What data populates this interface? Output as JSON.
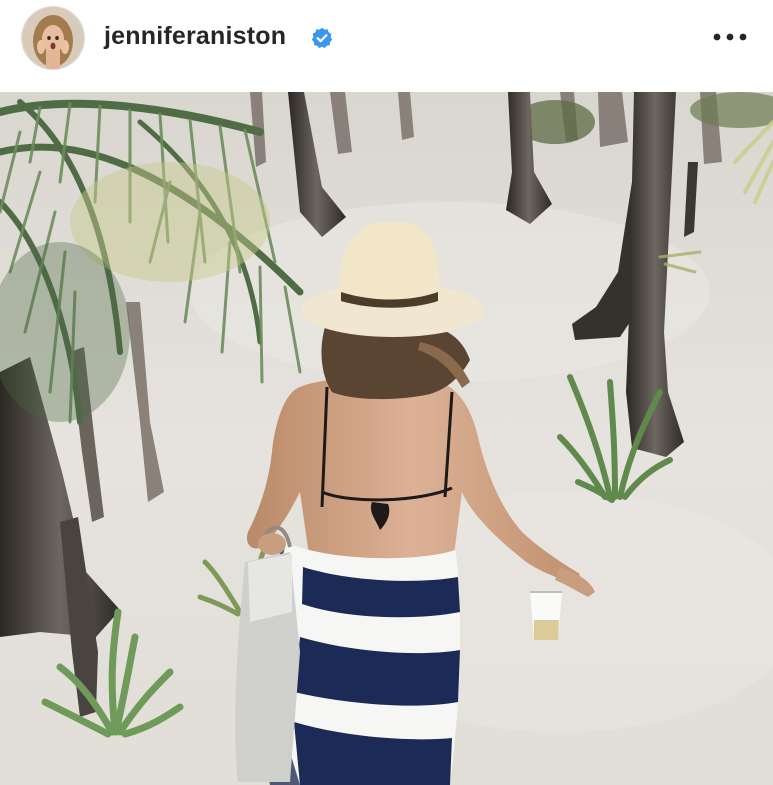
{
  "post": {
    "username": "jenniferaniston",
    "verified_icon": "verified-badge-icon",
    "more_icon": "more-horizontal-icon",
    "avatar_icon": "profile-avatar"
  },
  "colors": {
    "text": "#262626",
    "verified": "#3897f0",
    "sand": "#e6e3de"
  }
}
